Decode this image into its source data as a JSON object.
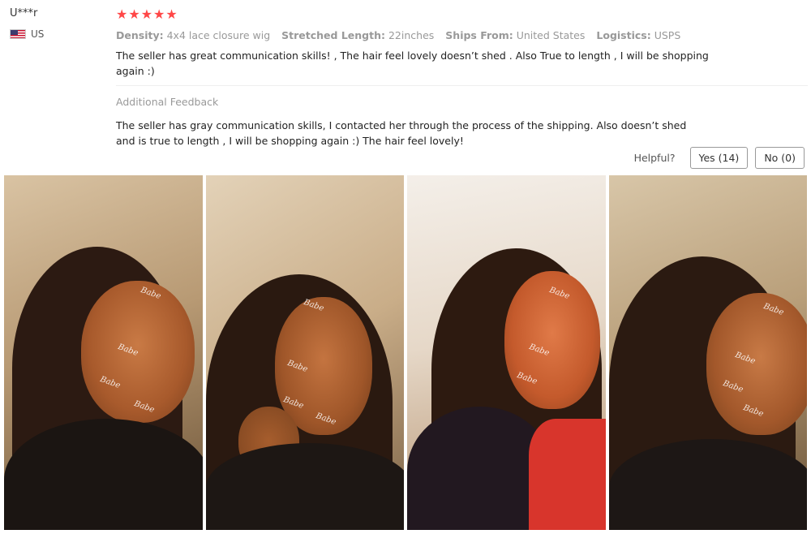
{
  "reviewer": {
    "name": "U***r",
    "country": "US"
  },
  "rating": {
    "stars": 5,
    "max": 5
  },
  "attributes": [
    {
      "label": "Density:",
      "value": "4x4 lace closure wig"
    },
    {
      "label": "Stretched Length:",
      "value": "22inches"
    },
    {
      "label": "Ships From:",
      "value": "United States"
    },
    {
      "label": "Logistics:",
      "value": "USPS"
    }
  ],
  "review_text": "The seller has great communication skills! , The hair feel lovely doesn’t shed . Also True to length , I will be shopping again :)",
  "additional": {
    "title": "Additional Feedback",
    "text": "The seller has gray communication skills, I contacted her through the process of the shipping. Also doesn’t shed and is true to length , I will be shopping again :) The hair feel lovely!"
  },
  "helpful": {
    "label": "Helpful?",
    "yes_label": "Yes (14)",
    "no_label": "No (0)"
  },
  "colors": {
    "star": "#ff4747",
    "muted_text": "#999999",
    "body_text": "#222222"
  },
  "photos": [
    {
      "name": "review-photo-1"
    },
    {
      "name": "review-photo-2"
    },
    {
      "name": "review-photo-3"
    },
    {
      "name": "review-photo-4"
    }
  ]
}
